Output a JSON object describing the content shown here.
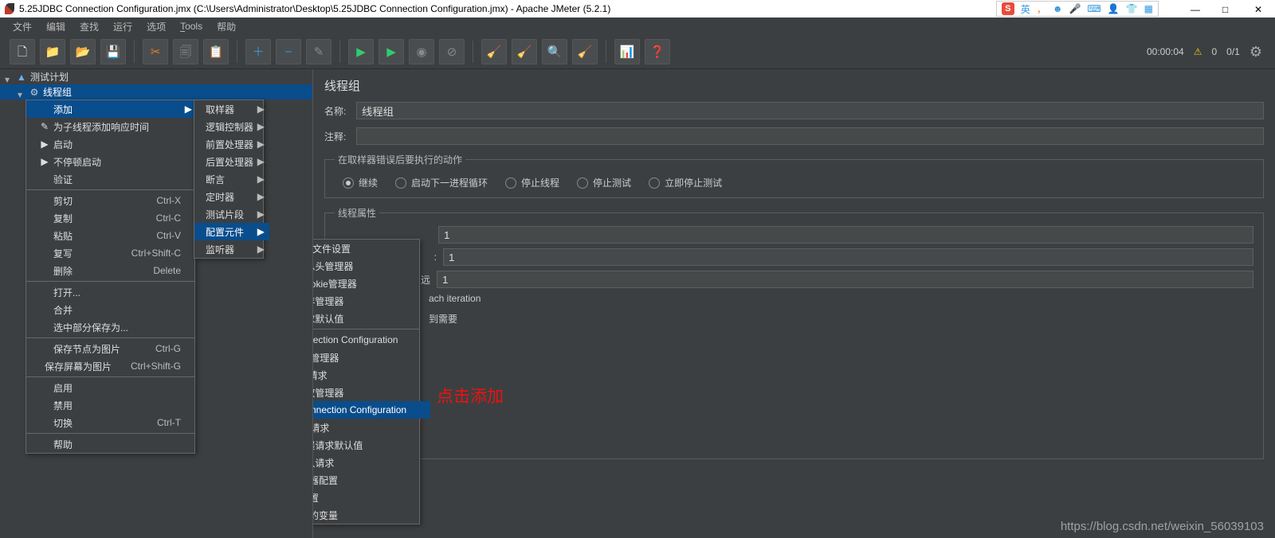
{
  "title": "5.25JDBC Connection Configuration.jmx (C:\\Users\\Administrator\\Desktop\\5.25JDBC Connection Configuration.jmx) - Apache JMeter (5.2.1)",
  "ime": {
    "s": "S",
    "lang": "英",
    "punct": "，"
  },
  "winbuttons": {
    "min": "—",
    "max": "□",
    "close": "✕"
  },
  "menus": [
    "文件",
    "编辑",
    "查找",
    "运行",
    "选项",
    "Tools",
    "帮助"
  ],
  "status": {
    "time": "00:00:04",
    "warn_count": "0",
    "ratio": "0/1"
  },
  "tree": {
    "root": "测试计划",
    "child": "线程组"
  },
  "panel": {
    "title": "线程组",
    "name_label": "名称:",
    "name_value": "线程组",
    "comment_label": "注释:",
    "comment_value": "",
    "err_legend": "在取样器错误后要执行的动作",
    "radios": [
      "继续",
      "启动下一进程循环",
      "停止线程",
      "停止测试",
      "立即停止测试"
    ],
    "attr_legend": "线程属性",
    "v1": "1",
    "v2": "1",
    "vforever": "远",
    "v3": "1",
    "iter": "ach iteration",
    "need": "到需要"
  },
  "ctx1": {
    "items": [
      {
        "label": "添加",
        "icon": "",
        "arrow": true,
        "hov": true
      },
      {
        "label": "为子线程添加响应时间",
        "icon": ""
      },
      {
        "label": "启动",
        "icon": ""
      },
      {
        "label": "不停顿启动",
        "icon": ""
      },
      {
        "label": "验证",
        "icon": ""
      },
      {
        "sep": true
      },
      {
        "label": "剪切",
        "shortcut": "Ctrl-X"
      },
      {
        "label": "复制",
        "shortcut": "Ctrl-C"
      },
      {
        "label": "粘贴",
        "shortcut": "Ctrl-V"
      },
      {
        "label": "复写",
        "shortcut": "Ctrl+Shift-C"
      },
      {
        "label": "删除",
        "shortcut": "Delete"
      },
      {
        "sep": true
      },
      {
        "label": "打开..."
      },
      {
        "label": "合并"
      },
      {
        "label": "选中部分保存为..."
      },
      {
        "sep": true
      },
      {
        "label": "保存节点为图片",
        "shortcut": "Ctrl-G"
      },
      {
        "label": "保存屏幕为图片",
        "shortcut": "Ctrl+Shift-G"
      },
      {
        "sep": true
      },
      {
        "label": "启用"
      },
      {
        "label": "禁用"
      },
      {
        "label": "切换",
        "shortcut": "Ctrl-T"
      },
      {
        "sep": true
      },
      {
        "label": "帮助"
      }
    ]
  },
  "ctx2": {
    "items": [
      {
        "label": "取样器",
        "arrow": true
      },
      {
        "label": "逻辑控制器",
        "arrow": true
      },
      {
        "label": "前置处理器",
        "arrow": true
      },
      {
        "label": "后置处理器",
        "arrow": true
      },
      {
        "label": "断言",
        "arrow": true
      },
      {
        "label": "定时器",
        "arrow": true
      },
      {
        "label": "测试片段",
        "arrow": true
      },
      {
        "label": "配置元件",
        "arrow": true,
        "hov": true
      },
      {
        "label": "监听器",
        "arrow": true
      }
    ]
  },
  "ctx3": {
    "items": [
      "CSV 数据文件设置",
      "HTTP信息头管理器",
      "HTTP Cookie管理器",
      "HTTP缓存管理器",
      "HTTP请求默认值",
      "Bolt Connection Configuration",
      "DNS缓存管理器",
      "FTP默认请求",
      "HTTP授权管理器",
      "JDBC Connection Configuration",
      "Java默认请求",
      "LDAP扩展请求默认值",
      "LDAP默认请求",
      "TCP取样器配置",
      "密钥库配置",
      "用户定义的变量"
    ],
    "hov_index": 9
  },
  "annotation": "点击添加",
  "watermark": "https://blog.csdn.net/weixin_56039103",
  "tb_icons": [
    "📄",
    "📂",
    "💾",
    "🖫",
    "✂",
    "📋",
    "📋",
    "✚",
    "−",
    "🖌",
    "▶",
    "▶",
    "◯",
    "⊘",
    "🐞",
    "🐞",
    "🔍",
    "🧹",
    "📊",
    "❓"
  ]
}
